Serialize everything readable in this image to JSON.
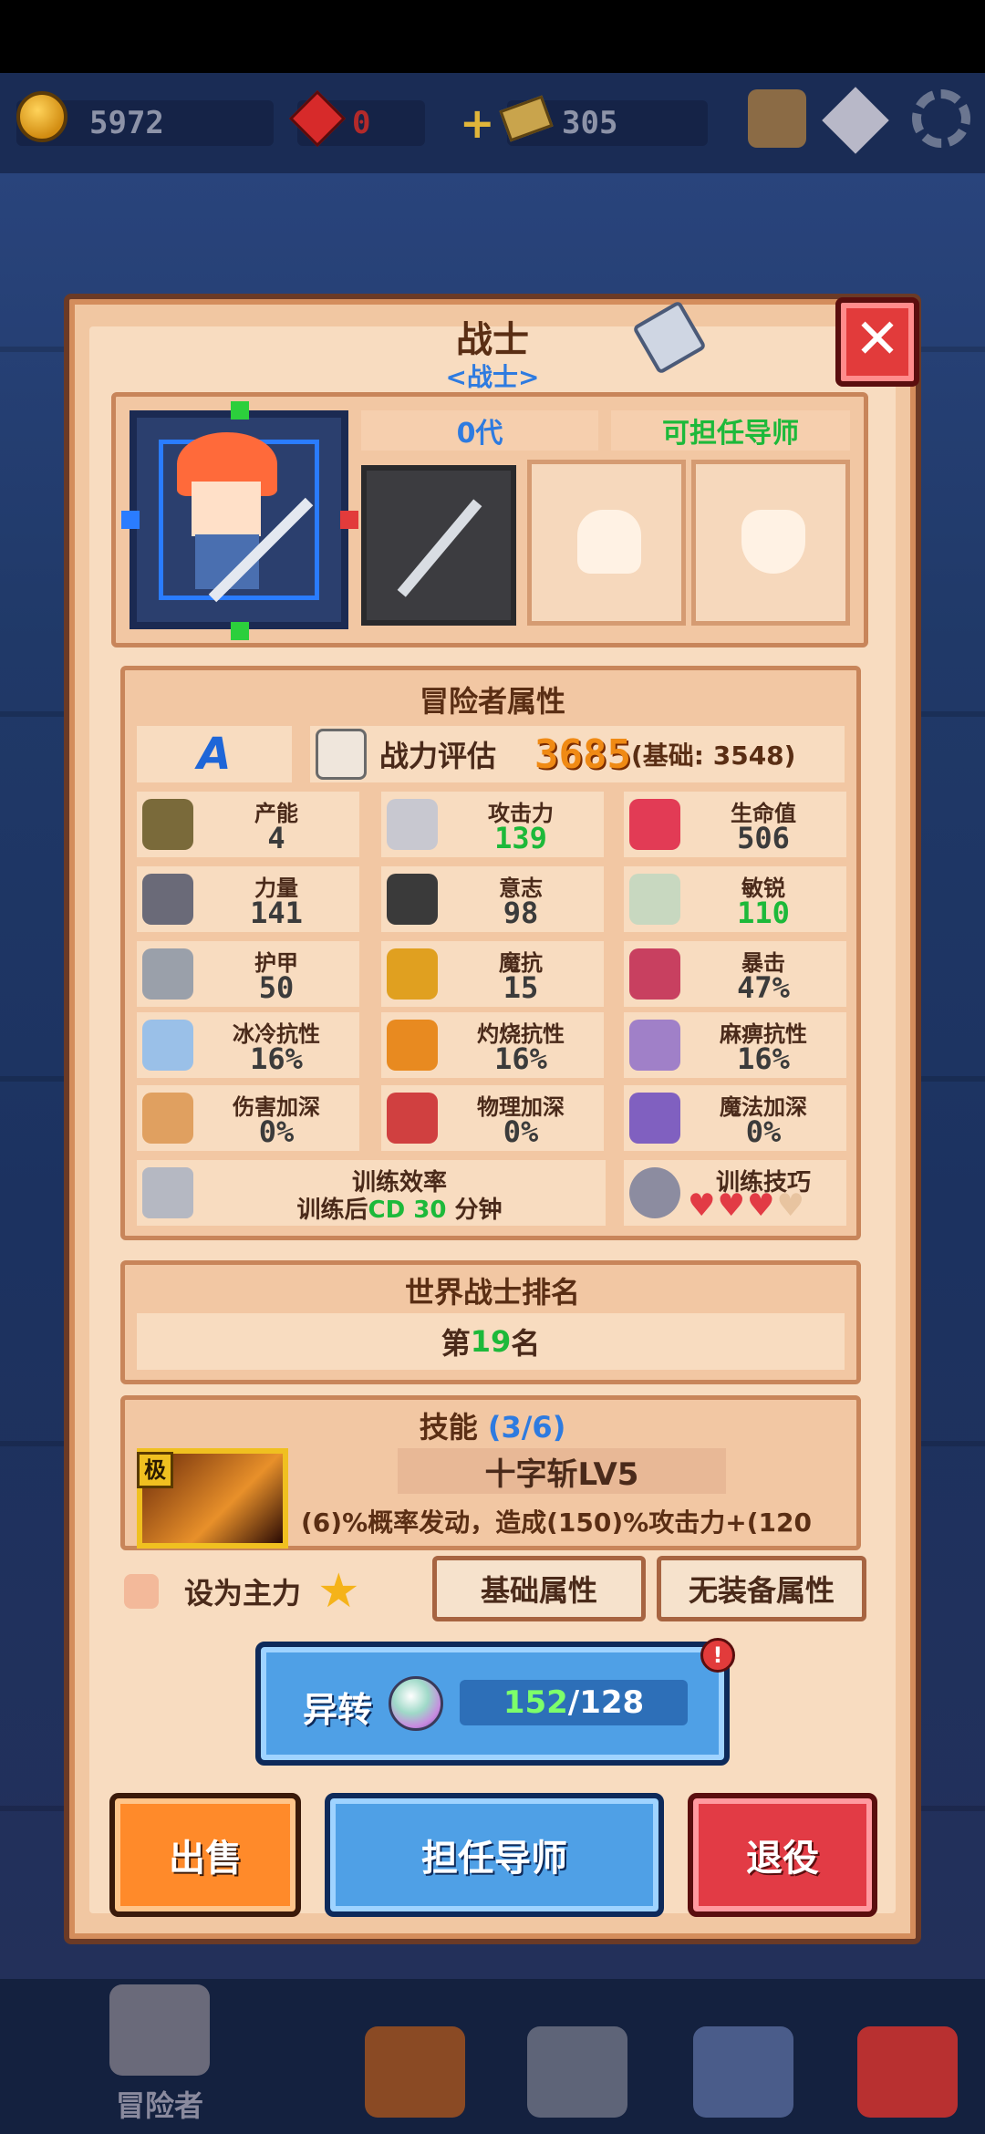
{
  "resources": {
    "gold": "5972",
    "gems": "0",
    "tickets": "305"
  },
  "hero": {
    "name": "战士",
    "class_tag": "<战士>",
    "generation": "0代",
    "mentor_status": "可担任导师"
  },
  "attributes": {
    "title": "冒险者属性",
    "rank_grade": "A",
    "power_label": "战力评估",
    "power_value": "3685",
    "power_base": "(基础: 3548)",
    "stats": [
      {
        "name": "产能",
        "value": "4",
        "highlight": false,
        "icon": "pot-icon"
      },
      {
        "name": "攻击力",
        "value": "139",
        "highlight": true,
        "icon": "sword-icon"
      },
      {
        "name": "生命值",
        "value": "506",
        "highlight": false,
        "icon": "health-cross-icon"
      },
      {
        "name": "力量",
        "value": "141",
        "highlight": false,
        "icon": "strength-fist-icon"
      },
      {
        "name": "意志",
        "value": "98",
        "highlight": false,
        "icon": "will-icon"
      },
      {
        "name": "敏锐",
        "value": "110",
        "highlight": true,
        "icon": "wing-icon"
      },
      {
        "name": "护甲",
        "value": "50",
        "highlight": false,
        "icon": "shield-icon"
      },
      {
        "name": "魔抗",
        "value": "15",
        "highlight": false,
        "icon": "magic-shield-icon"
      },
      {
        "name": "暴击",
        "value": "47%",
        "highlight": false,
        "icon": "crit-swords-icon"
      },
      {
        "name": "冰冷抗性",
        "value": "16%",
        "highlight": false,
        "icon": "ice-icon"
      },
      {
        "name": "灼烧抗性",
        "value": "16%",
        "highlight": false,
        "icon": "fire-icon"
      },
      {
        "name": "麻痹抗性",
        "value": "16%",
        "highlight": false,
        "icon": "paralysis-icon"
      },
      {
        "name": "伤害加深",
        "value": "0%",
        "highlight": false,
        "icon": "feather-icon"
      },
      {
        "name": "物理加深",
        "value": "0%",
        "highlight": false,
        "icon": "axe-icon"
      },
      {
        "name": "魔法加深",
        "value": "0%",
        "highlight": false,
        "icon": "staff-icon"
      }
    ],
    "training": {
      "label": "训练效率",
      "prefix": "训练后",
      "cd_label": "CD 30",
      "suffix": "分钟"
    },
    "training_skill": {
      "label": "训练技巧",
      "hearts_filled": 3,
      "hearts_total": 4
    }
  },
  "world_rank": {
    "title": "世界战士排名",
    "prefix": "第",
    "rank": "19",
    "suffix": "名"
  },
  "skills": {
    "title": "技能",
    "count": "(3/6)",
    "grade_badge": "极",
    "first_name": "十字斩LV5",
    "first_desc": "(6)%概率发动，造成(150)%攻击力+(120"
  },
  "controls": {
    "set_main_label": "设为主力",
    "tab_base": "基础属性",
    "tab_no_equip": "无装备属性",
    "transform_label": "异转",
    "transform_current": "152",
    "transform_required": "/128",
    "alert": "!",
    "sell": "出售",
    "mentor": "担任导师",
    "retire": "退役"
  },
  "bottom_nav": {
    "adventurer_label": "冒险者"
  },
  "colors": {
    "panel": "#f1c7a2",
    "panel_border": "#6b3a26",
    "green_value": "#1db93a",
    "blue_accent": "#2e7be0",
    "power_orange": "#f08a14",
    "close_red": "#e23b3b"
  }
}
